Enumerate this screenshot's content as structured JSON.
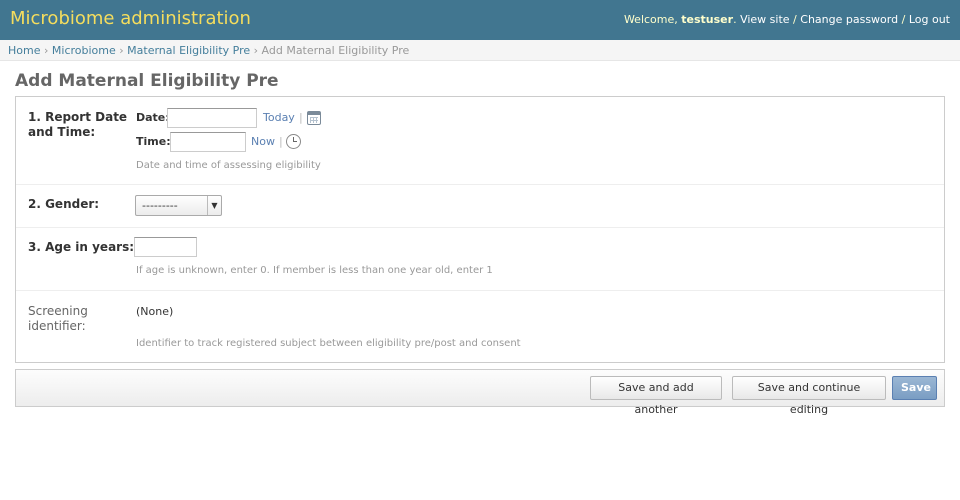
{
  "header": {
    "branding": "Microbiome administration",
    "welcome_prefix": "Welcome,",
    "username": "testuser",
    "view_site": "View site",
    "change_password": "Change password",
    "log_out": "Log out",
    "separator": "/"
  },
  "breadcrumbs": {
    "items": [
      "Home",
      "Microbiome",
      "Maternal Eligibility Pre"
    ],
    "current": "Add Maternal Eligibility Pre",
    "separator": "›"
  },
  "page_title": "Add Maternal Eligibility Pre",
  "form": {
    "report_datetime": {
      "label_line1": "1. Report Date",
      "label_line2": "and Time:",
      "date_label": "Date:",
      "date_value": "",
      "today_link": "Today",
      "time_label": "Time:",
      "time_value": "",
      "now_link": "Now",
      "link_separator": "|",
      "help": "Date and time of assessing eligibility"
    },
    "gender": {
      "label": "2. Gender:",
      "selected": "---------"
    },
    "age": {
      "label": "3. Age in years:",
      "value": "",
      "help": "If age is unknown, enter 0. If member is less than one year old, enter 1"
    },
    "screening_identifier": {
      "label_line1": "Screening",
      "label_line2": "identifier:",
      "value": "(None)",
      "help": "Identifier to track registered subject between eligibility pre/post and consent"
    }
  },
  "submit_row": {
    "save_add_another": "Save and add another",
    "save_continue": "Save and continue editing",
    "save": "Save"
  }
}
